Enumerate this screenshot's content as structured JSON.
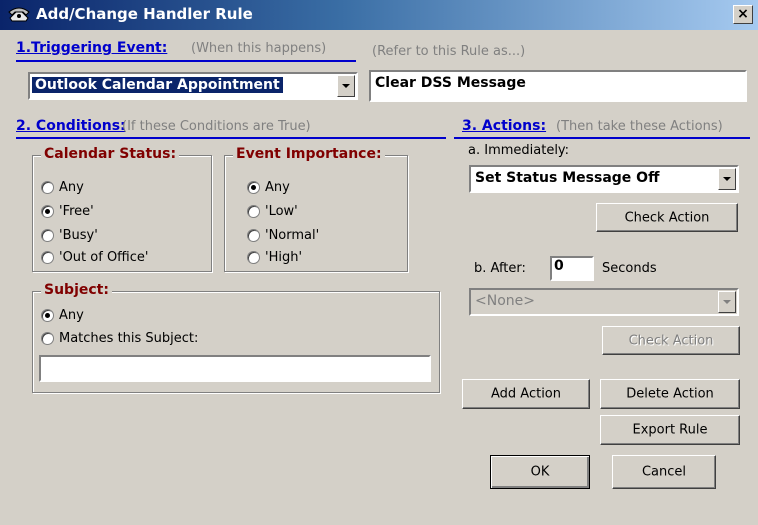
{
  "window": {
    "title": "Add/Change Handler Rule",
    "close": "×"
  },
  "triggering": {
    "heading": "1.Triggering Event:",
    "hint": "(When this happens)",
    "event_value": "Outlook Calendar Appointment",
    "refer_hint": "(Refer to this Rule as...)",
    "rule_name": "Clear DSS Message"
  },
  "conditions": {
    "heading": "2. Conditions:",
    "hint": "(If these Conditions are True)",
    "calendar_status": {
      "label": "Calendar Status:",
      "options": [
        "Any",
        "'Free'",
        "'Busy'",
        "'Out of Office'"
      ],
      "selected": 1
    },
    "event_importance": {
      "label": "Event Importance:",
      "options": [
        "Any",
        "'Low'",
        "'Normal'",
        "'High'"
      ],
      "selected": 0
    },
    "subject": {
      "label": "Subject:",
      "options": [
        "Any",
        "Matches this Subject:"
      ],
      "selected": 0,
      "value": ""
    }
  },
  "actions": {
    "heading": "3. Actions:",
    "hint": "(Then take these Actions)",
    "immediately_label": "a. Immediately:",
    "immediate_action": "Set Status Message Off",
    "check_action_1": "Check Action",
    "after_label": "b. After:",
    "after_value": "0",
    "seconds_label": "Seconds",
    "delayed_action": "<None>",
    "check_action_2": "Check Action"
  },
  "buttons": {
    "add_action": "Add Action",
    "delete_action": "Delete Action",
    "export_rule": "Export Rule",
    "ok": "OK",
    "cancel": "Cancel"
  }
}
